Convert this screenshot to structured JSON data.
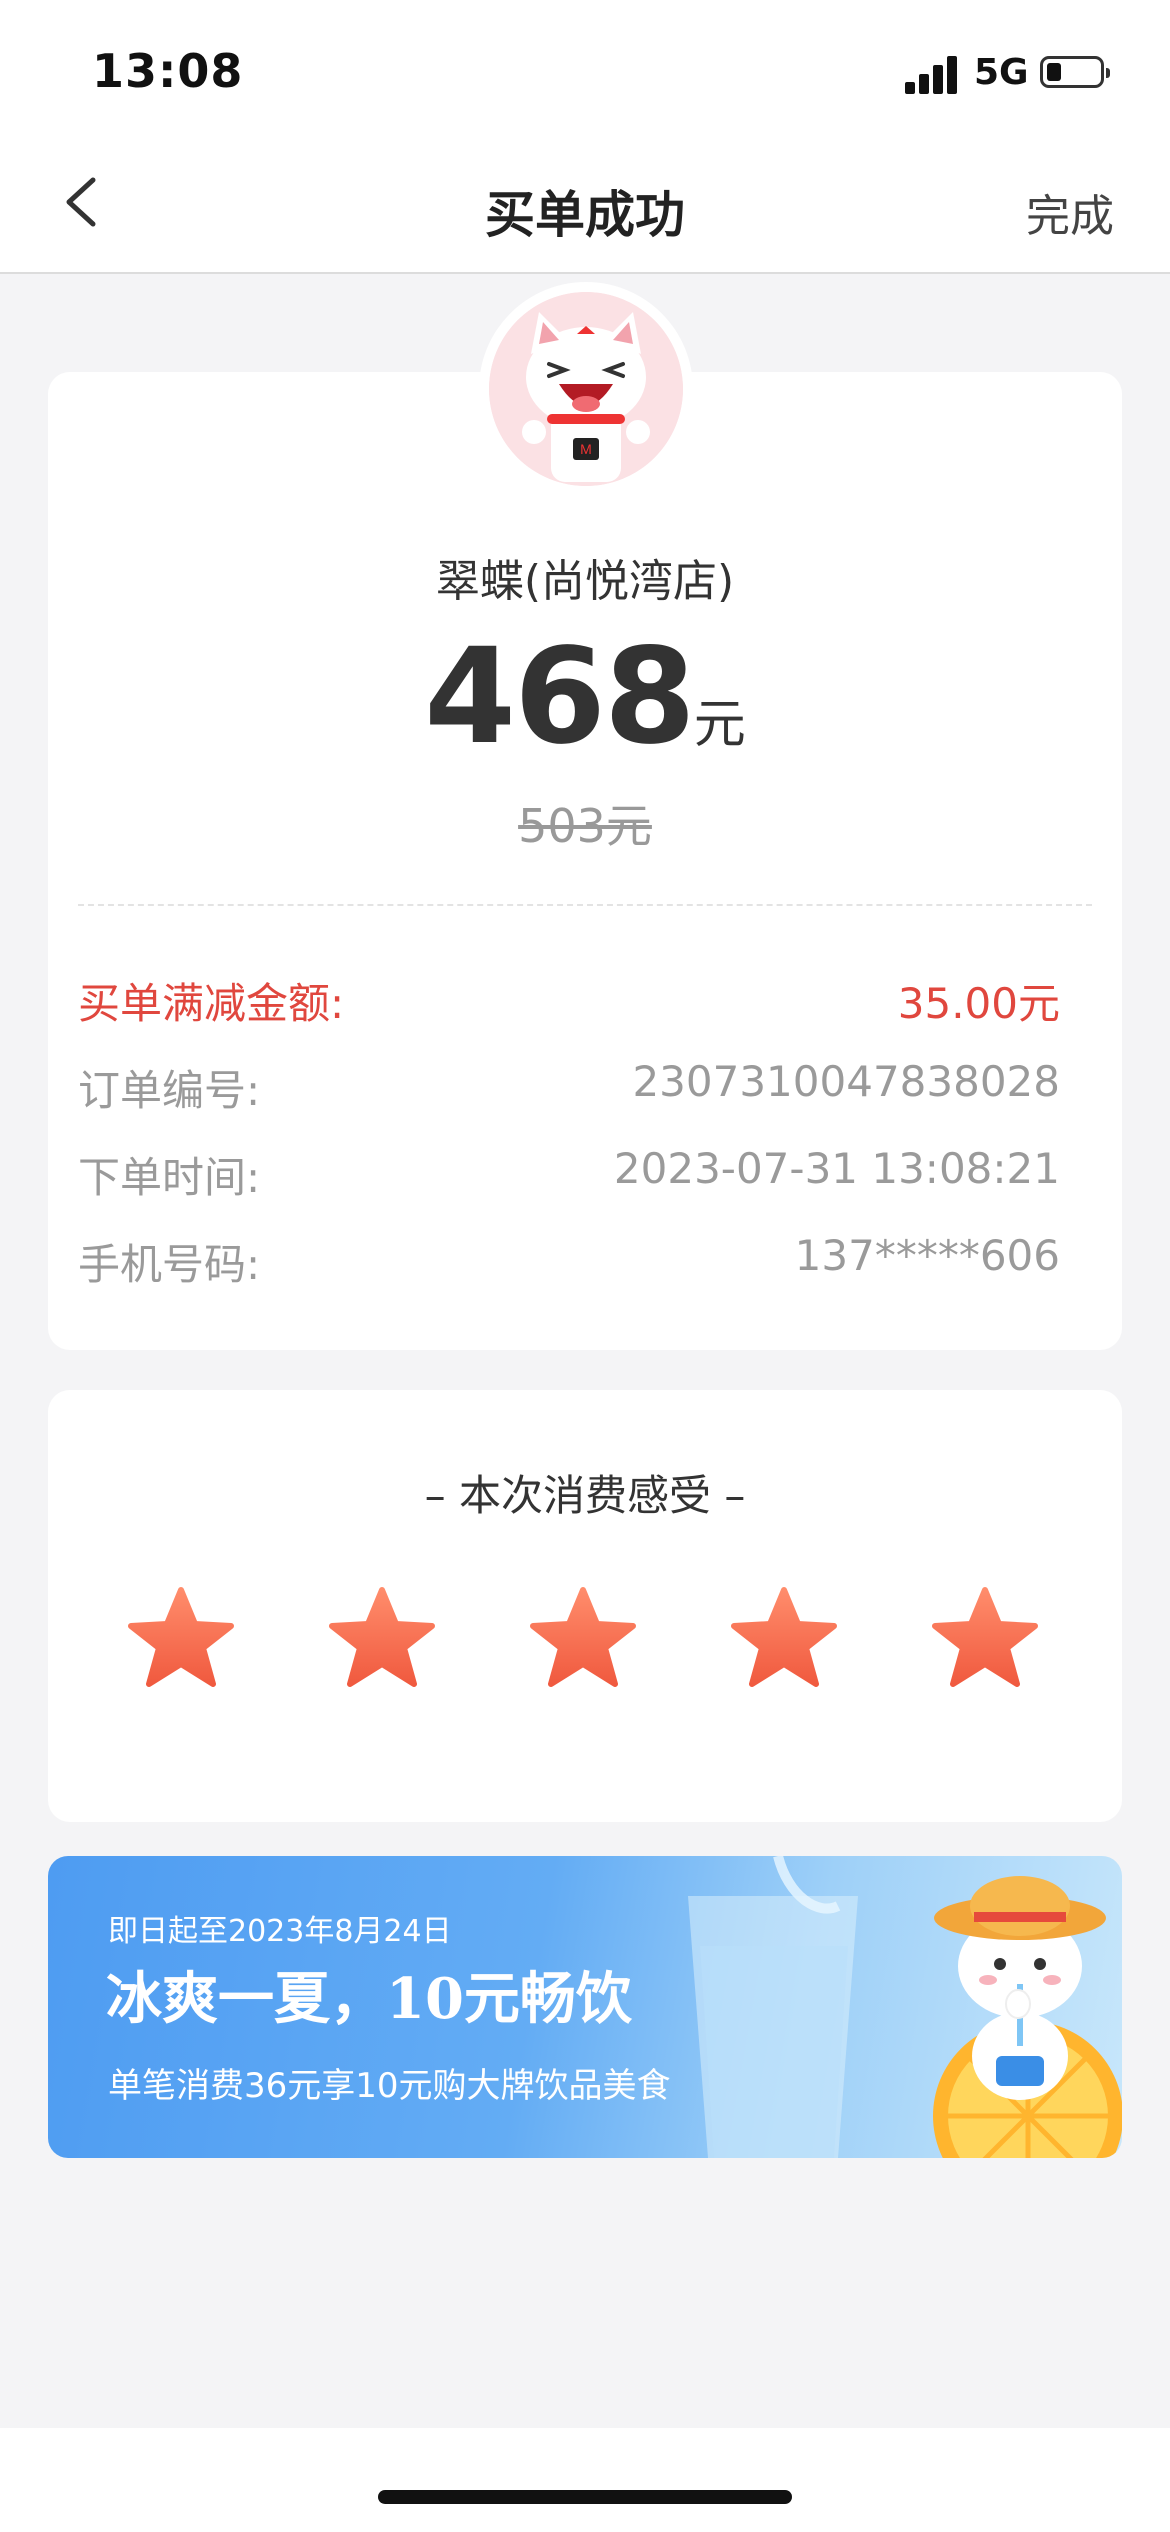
{
  "status_bar": {
    "time": "13:08",
    "network": "5G",
    "battery_level": 0.25
  },
  "nav": {
    "title": "买单成功",
    "done_label": "完成",
    "back_icon": "chevron-left-icon"
  },
  "order": {
    "shop_name": "翠蝶(尚悦湾店)",
    "paid_amount": "468",
    "paid_unit": "元",
    "original_amount": "503元",
    "details": [
      {
        "label": "买单满减金额:",
        "value": "35.00元",
        "highlight": true
      },
      {
        "label": "订单编号:",
        "value": "2307310047838028",
        "highlight": false
      },
      {
        "label": "下单时间:",
        "value": "2023-07-31 13:08:21",
        "highlight": false
      },
      {
        "label": "手机号码:",
        "value": "137*****606",
        "highlight": false
      }
    ]
  },
  "rating": {
    "title": "– 本次消费感受 –",
    "star_count": 5,
    "star_icon": "star-icon",
    "star_color": "#f26a4f"
  },
  "banner": {
    "subtitle": "即日起至2023年8月24日",
    "title": "冰爽一夏，10元畅饮",
    "description": "单笔消费36元享10元购大牌饮品美食"
  },
  "colors": {
    "highlight_red": "#e0473e",
    "page_bg": "#f4f4f6"
  }
}
